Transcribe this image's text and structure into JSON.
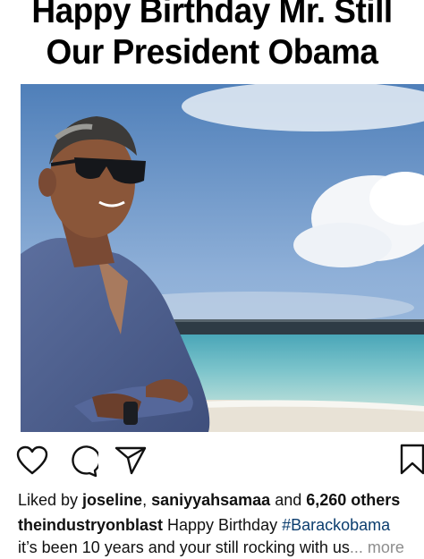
{
  "meme": {
    "line1": "Happy Birthday Mr. Still",
    "line2": "Our President Obama"
  },
  "post": {
    "actions": [
      {
        "name": "like-button",
        "icon": "heart-outline-icon"
      },
      {
        "name": "comment-button",
        "icon": "comment-bubble-icon"
      },
      {
        "name": "share-button",
        "icon": "paper-plane-icon"
      },
      {
        "name": "save-button",
        "icon": "bookmark-icon"
      }
    ],
    "likes": {
      "prefix": "Liked by ",
      "user1": "joseline",
      "sep": ", ",
      "user2": "saniyyahsamaa",
      "and": " and ",
      "count": "6,260 others"
    },
    "caption": {
      "username": "theindustryonblast",
      "text": " Happy Birthday ",
      "hashtag": "#Barackobama",
      "line2": "it’s been 10 years and your still rocking with us",
      "ellipsis": "...",
      "more": " more"
    }
  },
  "colors": {
    "hashtag": "#0b3d6e",
    "more": "#8e8e8e",
    "text": "#111111"
  }
}
